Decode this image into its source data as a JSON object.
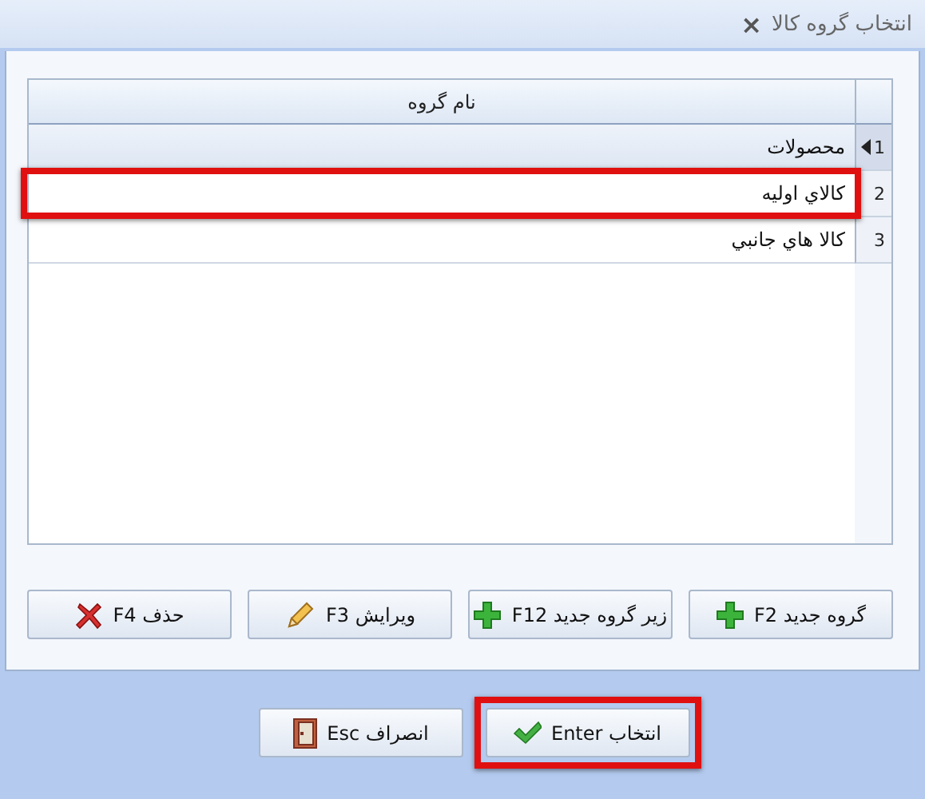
{
  "window": {
    "title": "انتخاب گروه کالا",
    "close": "×"
  },
  "grid": {
    "columns": [
      "نام گروه"
    ],
    "rows": [
      {
        "number": "1",
        "name": "محصولات",
        "selected": true,
        "highlighted": false
      },
      {
        "number": "2",
        "name": "کالاي اوليه",
        "selected": false,
        "highlighted": true
      },
      {
        "number": "3",
        "name": "کالا هاي جانبي",
        "selected": false,
        "highlighted": false
      }
    ]
  },
  "actions": [
    {
      "label": "گروه جدید F2",
      "kind": "plus"
    },
    {
      "label": "زیر گروه جدید F12",
      "kind": "plus"
    },
    {
      "label": "ویرایش F3",
      "kind": "pencil"
    },
    {
      "label": "حذف F4",
      "kind": "cross"
    }
  ],
  "footer_buttons": [
    {
      "label": "انتخاب Enter",
      "kind": "check",
      "highlighted": true
    },
    {
      "label": "انصراف Esc",
      "kind": "door",
      "highlighted": false
    }
  ]
}
